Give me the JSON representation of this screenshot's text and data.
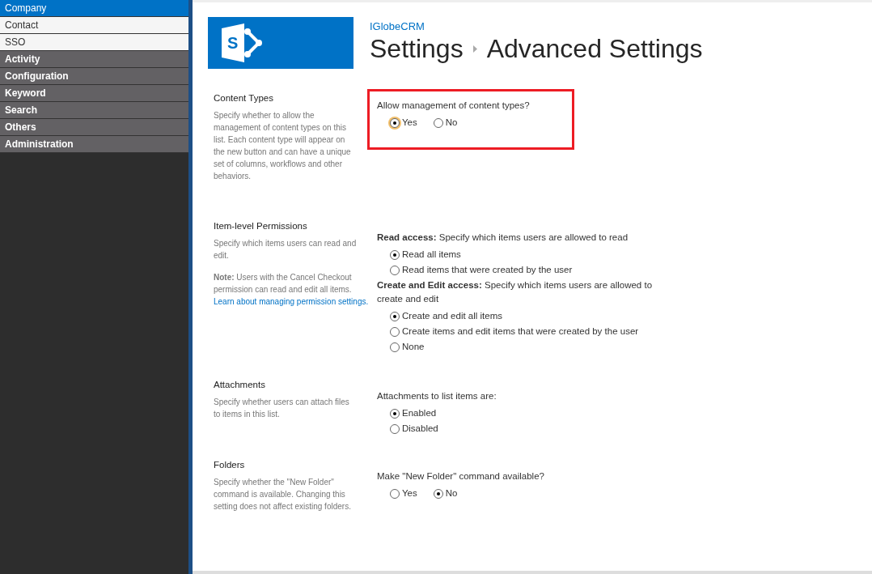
{
  "sidebar": {
    "items": [
      {
        "label": "Company",
        "kind": "sub",
        "selected": true
      },
      {
        "label": "Contact",
        "kind": "sub",
        "selected": false
      },
      {
        "label": "SSO",
        "kind": "sub",
        "selected": false
      },
      {
        "label": "Activity",
        "kind": "group",
        "selected": false
      },
      {
        "label": "Configuration",
        "kind": "group",
        "selected": false
      },
      {
        "label": "Keyword",
        "kind": "group",
        "selected": false
      },
      {
        "label": "Search",
        "kind": "group",
        "selected": false
      },
      {
        "label": "Others",
        "kind": "group",
        "selected": false
      },
      {
        "label": "Administration",
        "kind": "group",
        "selected": false
      }
    ]
  },
  "header": {
    "logo_letter": "S",
    "site_link": "IGlobeCRM",
    "breadcrumb": [
      "Settings",
      "Advanced Settings"
    ]
  },
  "sections": [
    {
      "title": "Content Types",
      "paragraphs": [
        "Specify whether to allow the management of content types on this list. Each content type will appear on the new button and can have a unique set of columns, workflows and other behaviors."
      ],
      "highlighted": true,
      "groups": [
        {
          "text": "Allow management of content types?",
          "kind": "inline",
          "options": [
            {
              "label": "Yes",
              "selected": true,
              "focused": true
            },
            {
              "label": "No",
              "selected": false,
              "focused": false
            }
          ]
        }
      ]
    },
    {
      "title": "Item-level Permissions",
      "paragraphs": [
        "Specify which items users can read and edit.",
        "**Note:** Users with the Cancel Checkout permission can read and edit all items."
      ],
      "link": "Learn about managing permission settings.",
      "highlighted": false,
      "groups": [
        {
          "text": "**Read access:**   Specify which items users are allowed to read",
          "kind": "stacked",
          "options": [
            {
              "label": "Read all items",
              "selected": true
            },
            {
              "label": "Read items that were created by the user",
              "selected": false
            }
          ]
        },
        {
          "text": "**Create and Edit access:**   Specify which items users are allowed to create and edit",
          "kind": "stacked",
          "options": [
            {
              "label": "Create and edit all items",
              "selected": true
            },
            {
              "label": "Create items and edit items that were created by the user",
              "selected": false
            },
            {
              "label": "None",
              "selected": false
            }
          ]
        }
      ]
    },
    {
      "title": "Attachments",
      "paragraphs": [
        "Specify whether users can attach files to items in this list."
      ],
      "highlighted": false,
      "groups": [
        {
          "text": "Attachments to list items are:",
          "kind": "stacked",
          "options": [
            {
              "label": "Enabled",
              "selected": true
            },
            {
              "label": "Disabled",
              "selected": false
            }
          ]
        }
      ]
    },
    {
      "title": "Folders",
      "paragraphs": [
        "Specify whether the \"New Folder\" command is available. Changing this setting does not affect existing folders."
      ],
      "highlighted": false,
      "groups": [
        {
          "text": "Make \"New Folder\" command available?",
          "kind": "inline",
          "options": [
            {
              "label": "Yes",
              "selected": false
            },
            {
              "label": "No",
              "selected": true
            }
          ]
        }
      ]
    }
  ]
}
